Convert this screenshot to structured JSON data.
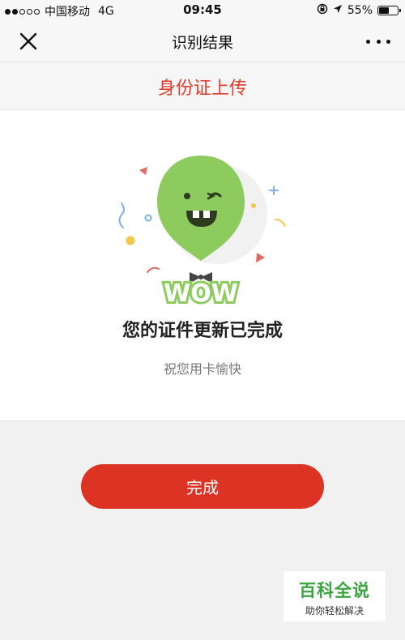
{
  "status_bar": {
    "carrier": "中国移动",
    "network": "4G",
    "time": "09:45",
    "battery_text": "55%",
    "battery_level": 0.55,
    "signal_bars_filled": 2,
    "signal_bars_total": 5
  },
  "nav": {
    "title": "识别结果",
    "close_icon": "close-icon",
    "more_icon": "more-dots-icon"
  },
  "section": {
    "title": "身份证上传"
  },
  "result": {
    "illustration_text": "WOW",
    "title": "您的证件更新已完成",
    "subtitle": "祝您用卡愉快"
  },
  "actions": {
    "done_label": "完成"
  },
  "watermark": {
    "title": "百科全说",
    "subtitle": "助你轻松解决"
  },
  "colors": {
    "accent_red": "#dd3324",
    "header_red": "#e23a2a",
    "balloon_green": "#8dcb5f",
    "watermark_green": "#3aa43e"
  }
}
